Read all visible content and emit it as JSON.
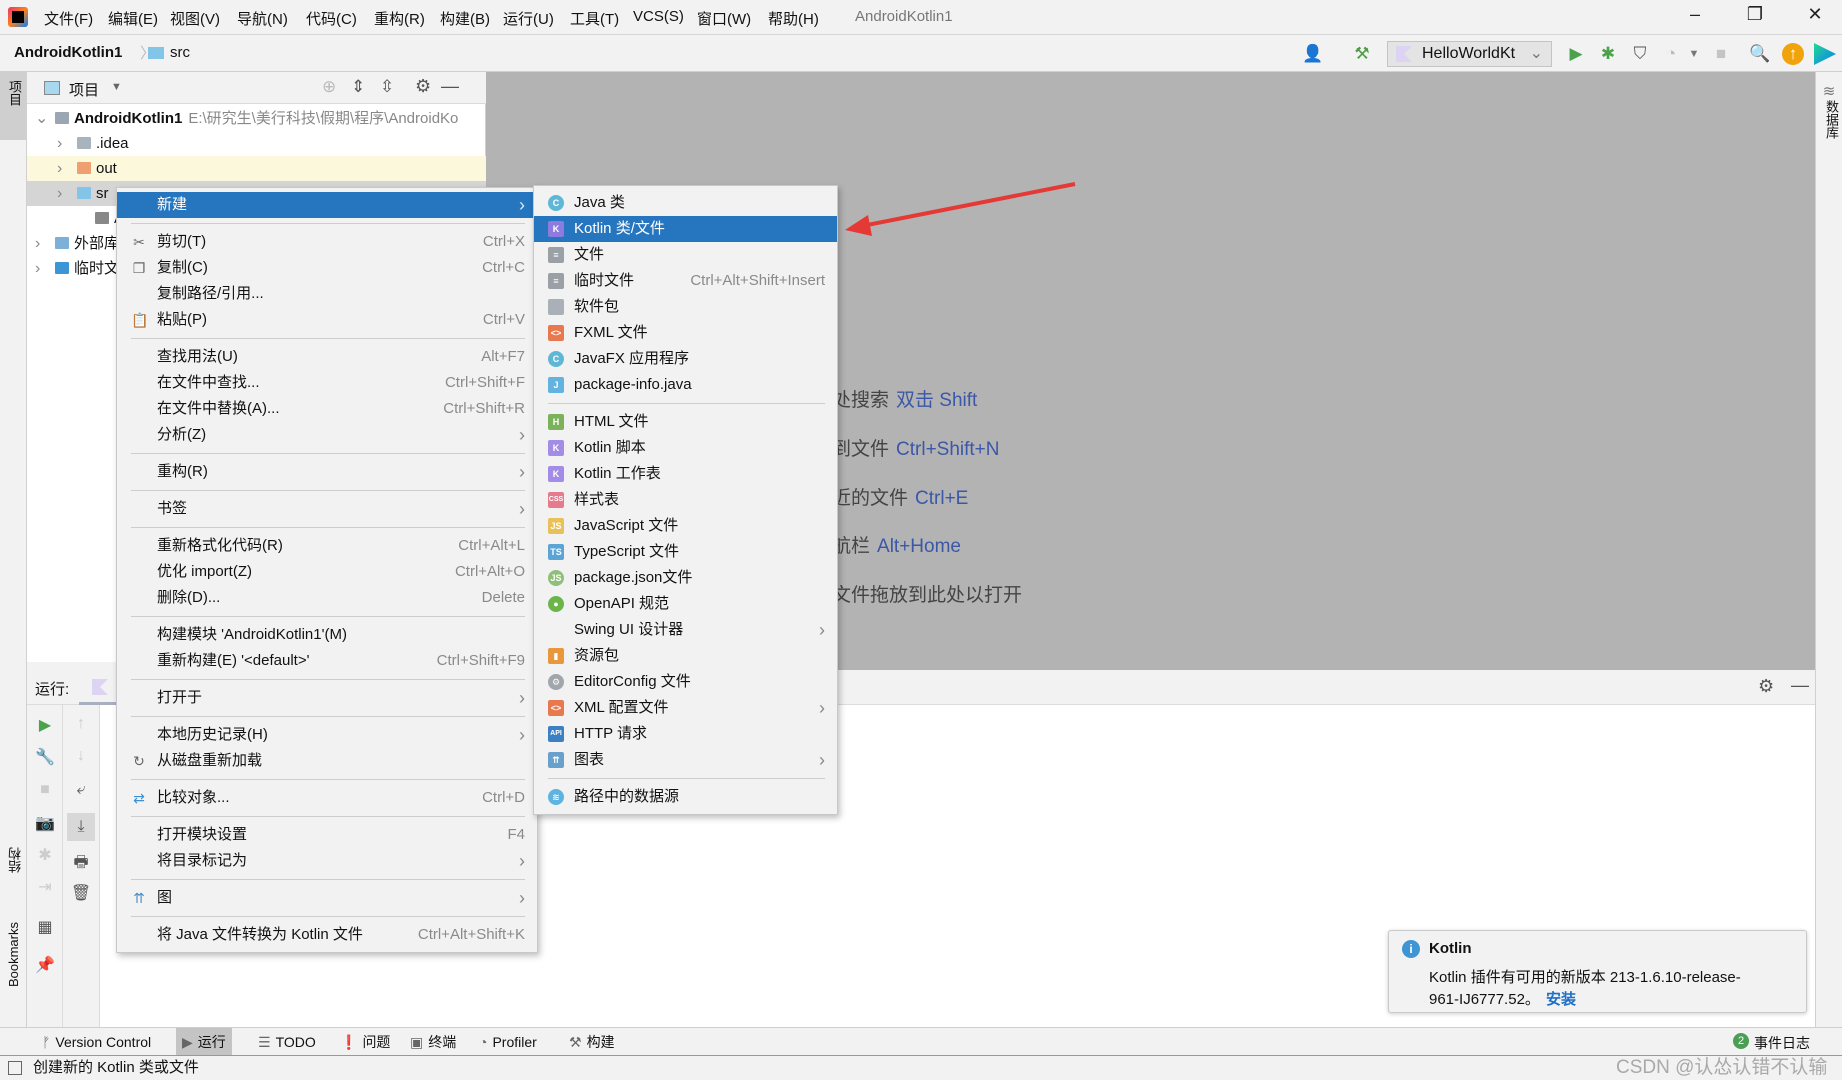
{
  "app": {
    "window_title": "AndroidKotlin1"
  },
  "menubar": [
    "文件(F)",
    "编辑(E)",
    "视图(V)",
    "导航(N)",
    "代码(C)",
    "重构(R)",
    "构建(B)",
    "运行(U)",
    "工具(T)",
    "VCS(S)",
    "窗口(W)",
    "帮助(H)"
  ],
  "breadcrumb": {
    "project": "AndroidKotlin1",
    "folder": "src"
  },
  "toolbar": {
    "run_config": "HelloWorldKt"
  },
  "left_strip": {
    "project": "项目",
    "structure": "结构",
    "bookmarks": "Bookmarks"
  },
  "right_strip": {
    "database": "数据库"
  },
  "project_panel": {
    "title": "项目",
    "tree": [
      {
        "label": "AndroidKotlin1",
        "path": "E:\\研究生\\美行科技\\假期\\程序\\AndroidKo",
        "icon": "module-icon"
      },
      {
        "label": ".idea",
        "icon": "folder-icon"
      },
      {
        "label": "out",
        "icon": "folder-orange-icon"
      },
      {
        "label": "sr",
        "icon": "folder-blue-icon"
      },
      {
        "label": "A",
        "icon": "file-icon"
      },
      {
        "label": "外部库",
        "icon": "library-icon"
      },
      {
        "label": "临时文",
        "icon": "scratch-icon"
      }
    ]
  },
  "editor_hints": [
    {
      "text": "处搜索",
      "key": "双击 Shift"
    },
    {
      "text": "到文件",
      "key": "Ctrl+Shift+N"
    },
    {
      "text": "近的文件",
      "key": "Ctrl+E"
    },
    {
      "text": "航栏",
      "key": "Alt+Home"
    },
    {
      "text": "文件拖放到此处以打开",
      "key": ""
    }
  ],
  "context_menu": [
    {
      "label": "新建",
      "arrow": true,
      "selected": true
    },
    {
      "sep": true
    },
    {
      "label": "剪切(T)",
      "shortcut": "Ctrl+X",
      "icon": "scissors-icon",
      "glyph": "✂"
    },
    {
      "label": "复制(C)",
      "shortcut": "Ctrl+C",
      "icon": "copy-icon",
      "glyph": "❐"
    },
    {
      "label": "复制路径/引用..."
    },
    {
      "label": "粘贴(P)",
      "shortcut": "Ctrl+V",
      "icon": "paste-icon",
      "glyph": "📋"
    },
    {
      "sep": true
    },
    {
      "label": "查找用法(U)",
      "shortcut": "Alt+F7"
    },
    {
      "label": "在文件中查找...",
      "shortcut": "Ctrl+Shift+F"
    },
    {
      "label": "在文件中替换(A)...",
      "shortcut": "Ctrl+Shift+R"
    },
    {
      "label": "分析(Z)",
      "arrow": true
    },
    {
      "sep": true
    },
    {
      "label": "重构(R)",
      "arrow": true
    },
    {
      "sep": true
    },
    {
      "label": "书签",
      "arrow": true
    },
    {
      "sep": true
    },
    {
      "label": "重新格式化代码(R)",
      "shortcut": "Ctrl+Alt+L"
    },
    {
      "label": "优化 import(Z)",
      "shortcut": "Ctrl+Alt+O"
    },
    {
      "label": "删除(D)...",
      "shortcut": "Delete"
    },
    {
      "sep": true
    },
    {
      "label": "构建模块 'AndroidKotlin1'(M)"
    },
    {
      "label": "重新构建(E) '<default>'",
      "shortcut": "Ctrl+Shift+F9"
    },
    {
      "sep": true
    },
    {
      "label": "打开于",
      "arrow": true
    },
    {
      "sep": true
    },
    {
      "label": "本地历史记录(H)",
      "arrow": true
    },
    {
      "label": "从磁盘重新加载",
      "icon": "reload-icon",
      "glyph": "↻"
    },
    {
      "sep": true
    },
    {
      "label": "比较对象...",
      "shortcut": "Ctrl+D",
      "icon": "compare-icon",
      "glyph": "⇄",
      "color": "#3d8fd1"
    },
    {
      "sep": true
    },
    {
      "label": "打开模块设置",
      "shortcut": "F4"
    },
    {
      "label": "将目录标记为",
      "arrow": true
    },
    {
      "sep": true
    },
    {
      "label": "图",
      "arrow": true,
      "icon": "diagram-icon",
      "glyph": "⇈",
      "color": "#4a90c8"
    },
    {
      "sep": true
    },
    {
      "label": "将 Java 文件转换为 Kotlin 文件",
      "shortcut": "Ctrl+Alt+Shift+K"
    }
  ],
  "submenu": [
    {
      "label": "Java 类",
      "icon": "java-class-icon",
      "glyph": "C",
      "bg": "#5fb7d6",
      "round": true
    },
    {
      "label": "Kotlin 类/文件",
      "icon": "kotlin-file-icon",
      "glyph": "K",
      "bg": "#8d7be0",
      "selected": true
    },
    {
      "label": "文件",
      "icon": "file-icon",
      "glyph": "≡",
      "bg": "#9aa0a6"
    },
    {
      "label": "临时文件",
      "shortcut": "Ctrl+Alt+Shift+Insert",
      "icon": "scratch-file-icon",
      "glyph": "≡",
      "bg": "#9aa0a6"
    },
    {
      "label": "软件包",
      "icon": "package-icon",
      "glyph": "",
      "bg": "#a9b0b7"
    },
    {
      "label": "FXML 文件",
      "icon": "fxml-icon",
      "glyph": "<>",
      "bg": "#e8794f"
    },
    {
      "label": "JavaFX 应用程序",
      "icon": "javafx-icon",
      "glyph": "C",
      "bg": "#5fb7d6",
      "round": true
    },
    {
      "label": "package-info.java",
      "icon": "java-file-icon",
      "glyph": "J",
      "bg": "#62b3e0"
    },
    {
      "sep": true
    },
    {
      "label": "HTML 文件",
      "icon": "html-icon",
      "glyph": "H",
      "bg": "#7cb35a"
    },
    {
      "label": "Kotlin 脚本",
      "icon": "kotlin-script-icon",
      "glyph": "K",
      "bg": "#a38be8"
    },
    {
      "label": "Kotlin 工作表",
      "icon": "kotlin-worksheet-icon",
      "glyph": "K",
      "bg": "#a38be8"
    },
    {
      "label": "样式表",
      "icon": "css-icon",
      "glyph": "CSS",
      "bg": "#e77b8e"
    },
    {
      "label": "JavaScript 文件",
      "icon": "javascript-icon",
      "glyph": "JS",
      "bg": "#e8c15a"
    },
    {
      "label": "TypeScript 文件",
      "icon": "typescript-icon",
      "glyph": "TS",
      "bg": "#5aa5d6"
    },
    {
      "label": "package.json文件",
      "icon": "nodejs-icon",
      "glyph": "JS",
      "bg": "#8fbf7a",
      "round": true
    },
    {
      "label": "OpenAPI 规范",
      "icon": "openapi-icon",
      "glyph": "●",
      "bg": "#6bb54a",
      "round": true
    },
    {
      "label": "Swing UI 设计器",
      "arrow": true
    },
    {
      "label": "资源包",
      "icon": "resource-bundle-icon",
      "glyph": "▮",
      "bg": "#e9973c"
    },
    {
      "label": "EditorConfig 文件",
      "icon": "gear-icon",
      "glyph": "⚙",
      "bg": "#a0a6ab",
      "round": true
    },
    {
      "label": "XML 配置文件",
      "arrow": true,
      "icon": "xml-icon",
      "glyph": "<>",
      "bg": "#e8794f"
    },
    {
      "label": "HTTP 请求",
      "icon": "http-request-icon",
      "glyph": "API",
      "bg": "#3b7fc4"
    },
    {
      "label": "图表",
      "arrow": true,
      "icon": "diagram-icon",
      "glyph": "⇈",
      "bg": "#6aa0cc"
    },
    {
      "sep": true
    },
    {
      "label": "路径中的数据源",
      "icon": "datasource-icon",
      "glyph": "≋",
      "bg": "#5db4e0",
      "round": true
    }
  ],
  "run_panel": {
    "label": "运行:"
  },
  "bottom_tabs": [
    {
      "label": "Version Control",
      "icon": "vcs-icon",
      "glyph": "ᚠ"
    },
    {
      "label": "运行",
      "icon": "run-icon",
      "glyph": "▶",
      "active": true
    },
    {
      "label": "TODO",
      "icon": "list-icon",
      "glyph": "☰"
    },
    {
      "label": "问题",
      "icon": "problems-icon",
      "glyph": "❗"
    },
    {
      "label": "终端",
      "icon": "terminal-icon",
      "glyph": "▣"
    },
    {
      "label": "Profiler",
      "icon": "profiler-icon",
      "glyph": "◔"
    },
    {
      "label": "构建",
      "icon": "hammer-icon",
      "glyph": "⚒"
    }
  ],
  "event_log": {
    "count": "2",
    "label": "事件日志"
  },
  "status": {
    "text": "创建新的 Kotlin 类或文件"
  },
  "notification": {
    "title": "Kotlin",
    "line1": "Kotlin 插件有可用的新版本 213-1.6.10-release-",
    "line2": "961-IJ6777.52。",
    "action": "安装"
  },
  "watermark": "CSDN @认怂认错不认输",
  "colors": {
    "accent": "#2675bf",
    "arrow": "#e53935",
    "link": "#1e6fc8"
  }
}
